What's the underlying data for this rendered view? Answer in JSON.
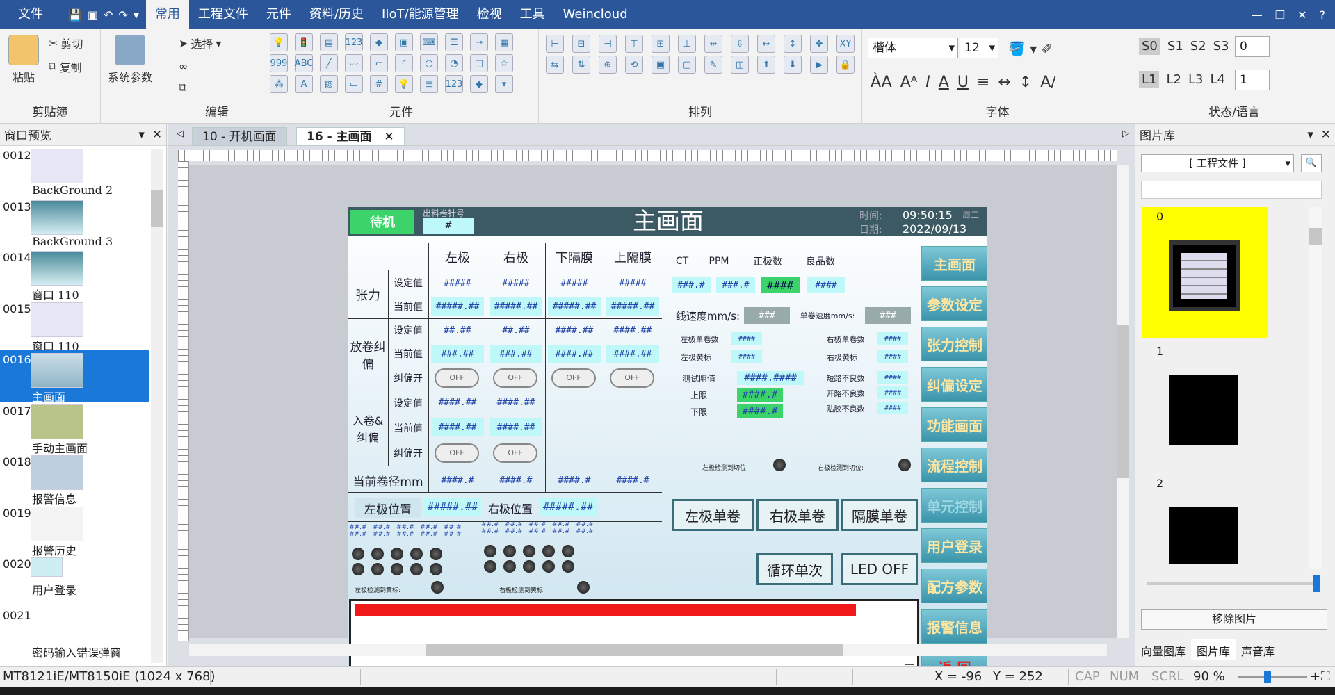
{
  "menubar": {
    "file": "文件",
    "tabs": [
      "常用",
      "工程文件",
      "元件",
      "资料/历史",
      "IIoT/能源管理",
      "检视",
      "工具",
      "Weincloud"
    ],
    "active": "常用"
  },
  "ribbon": {
    "clipboard": {
      "paste": "粘贴",
      "cut": "剪切",
      "copy": "复制",
      "label": "剪贴簿"
    },
    "system": {
      "label": "系统参数"
    },
    "edit": {
      "select": "选择",
      "label": "编辑"
    },
    "components": {
      "label": "元件"
    },
    "arrange": {
      "label": "排列"
    },
    "font": {
      "name": "楷体",
      "size": "12",
      "label": "字体"
    },
    "state": {
      "states": [
        "S0",
        "S1",
        "S2",
        "S3"
      ],
      "state_value": "0",
      "langs": [
        "L1",
        "L2",
        "L3",
        "L4"
      ],
      "lang_value": "1",
      "label": "状态/语言"
    }
  },
  "leftpanel": {
    "title": "窗口预览",
    "items": [
      {
        "num": "0012",
        "label": "BackGround  2"
      },
      {
        "num": "0013",
        "label": "BackGround  3"
      },
      {
        "num": "0014",
        "label": "窗口  110"
      },
      {
        "num": "0015",
        "label": "窗口  110"
      },
      {
        "num": "0016",
        "label": "主画面"
      },
      {
        "num": "0017",
        "label": "手动主画面"
      },
      {
        "num": "0018",
        "label": "报警信息"
      },
      {
        "num": "0019",
        "label": "报警历史"
      },
      {
        "num": "0020",
        "label": "用户登录"
      },
      {
        "num": "0021",
        "label": "密码输入错误弹窗"
      }
    ]
  },
  "doc": {
    "tabs": [
      "10 - 开机画面",
      "16 - 主画面"
    ]
  },
  "hmi": {
    "status": "待机",
    "roll_label": "出料卷针号",
    "roll_value": "#",
    "title": "主画面",
    "time_label": "时间:",
    "time": "09:50:15",
    "weekday": "周二",
    "date_label": "日期:",
    "date": "2022/09/13",
    "cols": [
      "左极",
      "右极",
      "下隔膜",
      "上隔膜"
    ],
    "tension": "张力",
    "set": "设定值",
    "current": "当前值",
    "unwind": "放卷纠偏",
    "rewind": "入卷&纠偏",
    "correct_on": "纠偏开",
    "off": "OFF",
    "diameter": "当前卷径mm",
    "left_pos": "左极位置",
    "right_pos": "右极位置",
    "pos_val": "#####.##",
    "v5": "#####",
    "v52": "#####.##",
    "v22": "##.##",
    "v42": "####.##",
    "v32": "###.##",
    "v41": "####.#",
    "ct": "CT",
    "ppm": "PPM",
    "good_count": "正极数",
    "good": "良品数",
    "v31": "###.#",
    "v4": "####",
    "v3": "###",
    "line_speed": "线速度mm/s:",
    "roll_speed": "单卷速度mm/s:",
    "left_single": "左极单卷数",
    "right_single": "右极单卷数",
    "left_mark": "左极黄标",
    "right_mark": "右极黄标",
    "res": "测试阻值",
    "res_val": "####.####",
    "upper": "上限",
    "lower": "下限",
    "limit_val": "####.#",
    "short_ng": "短路不良数",
    "open_ng": "开路不良数",
    "tape_ng": "贴胶不良数",
    "left_cut": "左极检测到切位:",
    "right_cut": "右极检测到切位:",
    "left_yellow": "左极检测到黄标:",
    "right_yellow": "右极检测到黄标:",
    "btn_left": "左极单卷",
    "btn_right": "右极单卷",
    "btn_sep": "隔膜单卷",
    "btn_cycle": "循环单次",
    "btn_led": "LED OFF",
    "mini": "##.#",
    "side": [
      "主画面",
      "参数设定",
      "张力控制",
      "纠偏设定",
      "功能画面",
      "流程控制",
      "单元控制",
      "用户登录",
      "配方参数",
      "报警信息",
      "返  回"
    ]
  },
  "rightpanel": {
    "title": "图片库",
    "dropdown": "[ 工程文件 ]",
    "items": [
      "0",
      "1",
      "2"
    ],
    "remove": "移除图片",
    "tabs": [
      "向量图库",
      "图片库",
      "声音库"
    ]
  },
  "status": {
    "model": "MT8121iE/MT8150iE (1024 x 768)",
    "x": "X = -96",
    "y": "Y = 252",
    "cap": "CAP",
    "num": "NUM",
    "scrl": "SCRL",
    "zoom": "90 %"
  }
}
